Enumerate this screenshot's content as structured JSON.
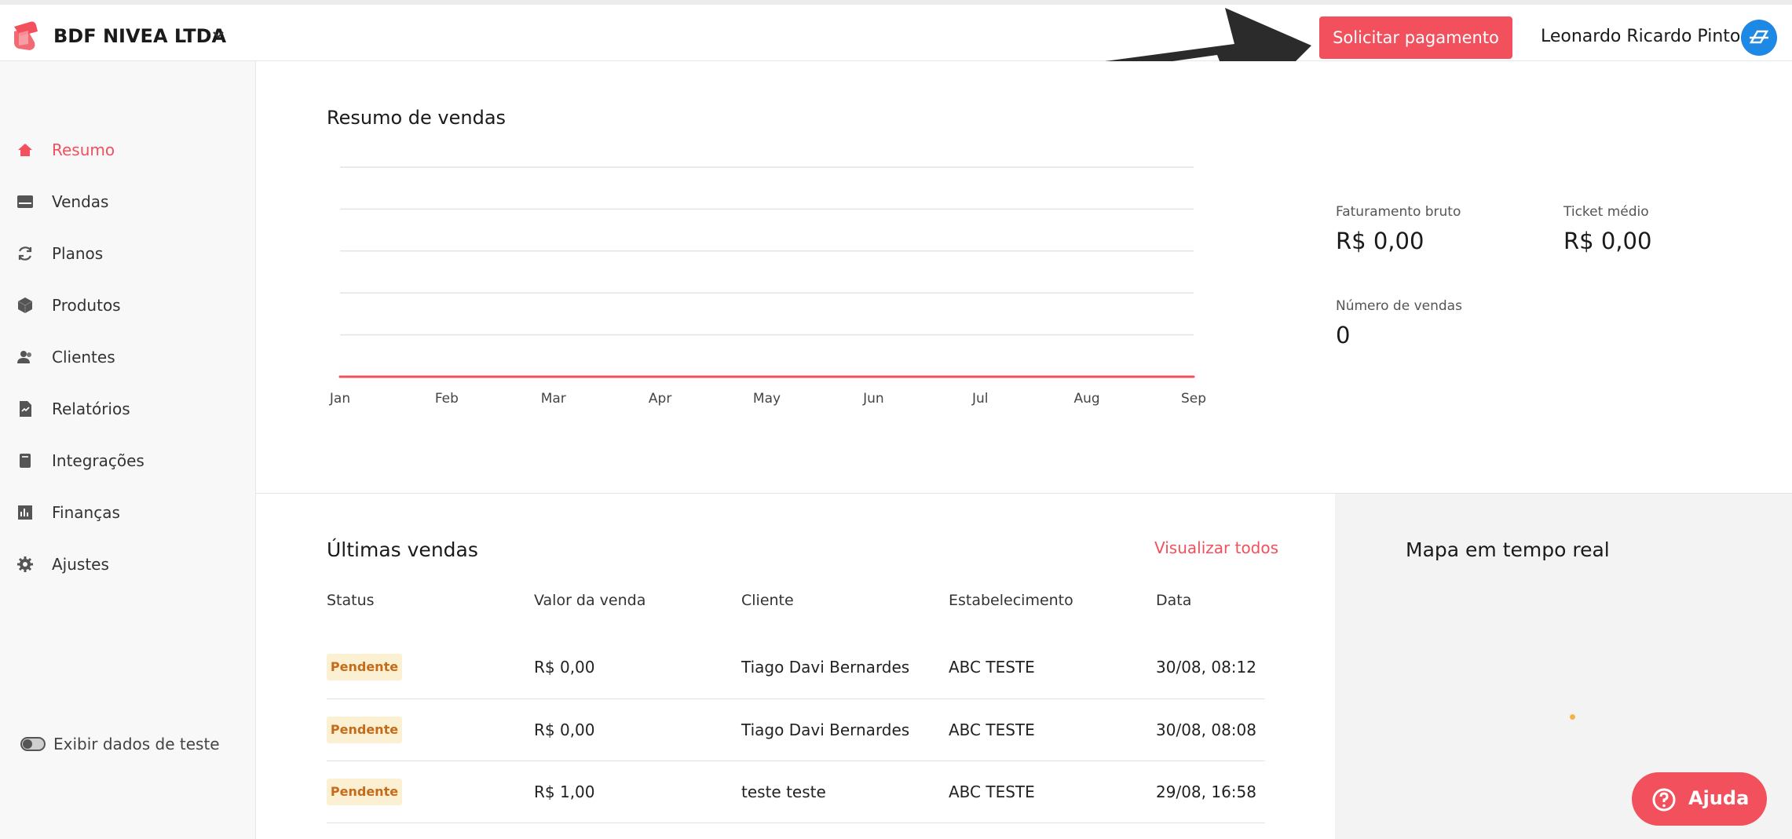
{
  "header": {
    "company": "BDF NIVEA LTDA",
    "pay_button": "Solicitar pagamento",
    "user_name": "Leonardo Ricardo Pinto"
  },
  "sidebar": {
    "items": [
      {
        "label": "Resumo",
        "icon": "home-icon",
        "active": true
      },
      {
        "label": "Vendas",
        "icon": "sales-icon",
        "active": false
      },
      {
        "label": "Planos",
        "icon": "refresh-icon",
        "active": false
      },
      {
        "label": "Produtos",
        "icon": "box-icon",
        "active": false
      },
      {
        "label": "Clientes",
        "icon": "users-icon",
        "active": false
      },
      {
        "label": "Relatórios",
        "icon": "report-icon",
        "active": false
      },
      {
        "label": "Integrações",
        "icon": "integration-icon",
        "active": false
      },
      {
        "label": "Finanças",
        "icon": "finance-icon",
        "active": false
      },
      {
        "label": "Ajustes",
        "icon": "gear-icon",
        "active": false
      }
    ],
    "test_toggle_label": "Exibir dados de teste"
  },
  "summary": {
    "title": "Resumo de vendas",
    "stats": {
      "gross_label": "Faturamento bruto",
      "gross_value": "R$ 0,00",
      "ticket_label": "Ticket médio",
      "ticket_value": "R$ 0,00",
      "count_label": "Número de vendas",
      "count_value": "0"
    }
  },
  "chart_data": {
    "type": "line",
    "categories": [
      "Jan",
      "Feb",
      "Mar",
      "Apr",
      "May",
      "Jun",
      "Jul",
      "Aug",
      "Sep"
    ],
    "series": [
      {
        "values": [
          0,
          0,
          0,
          0,
          0,
          0,
          0,
          0,
          0
        ],
        "color": "#f1505c"
      }
    ],
    "gridlines": 5,
    "grid": true
  },
  "sales": {
    "title": "Últimas vendas",
    "view_all": "Visualizar todos",
    "columns": [
      "Status",
      "Valor da venda",
      "Cliente",
      "Estabelecimento",
      "Data"
    ],
    "rows": [
      {
        "status": "Pendente",
        "value": "R$ 0,00",
        "client": "Tiago Davi Bernardes",
        "store": "ABC TESTE",
        "date": "30/08, 08:12"
      },
      {
        "status": "Pendente",
        "value": "R$ 0,00",
        "client": "Tiago Davi Bernardes",
        "store": "ABC TESTE",
        "date": "30/08, 08:08"
      },
      {
        "status": "Pendente",
        "value": "R$ 1,00",
        "client": "teste teste",
        "store": "ABC TESTE",
        "date": "29/08, 16:58"
      }
    ]
  },
  "map": {
    "title": "Mapa em tempo real"
  },
  "help": {
    "label": "Ajuda"
  },
  "colors": {
    "accent": "#f1505c",
    "badge_bg": "#fcf0d2",
    "badge_text": "#c66b1a",
    "avatar": "#1e88e5"
  }
}
